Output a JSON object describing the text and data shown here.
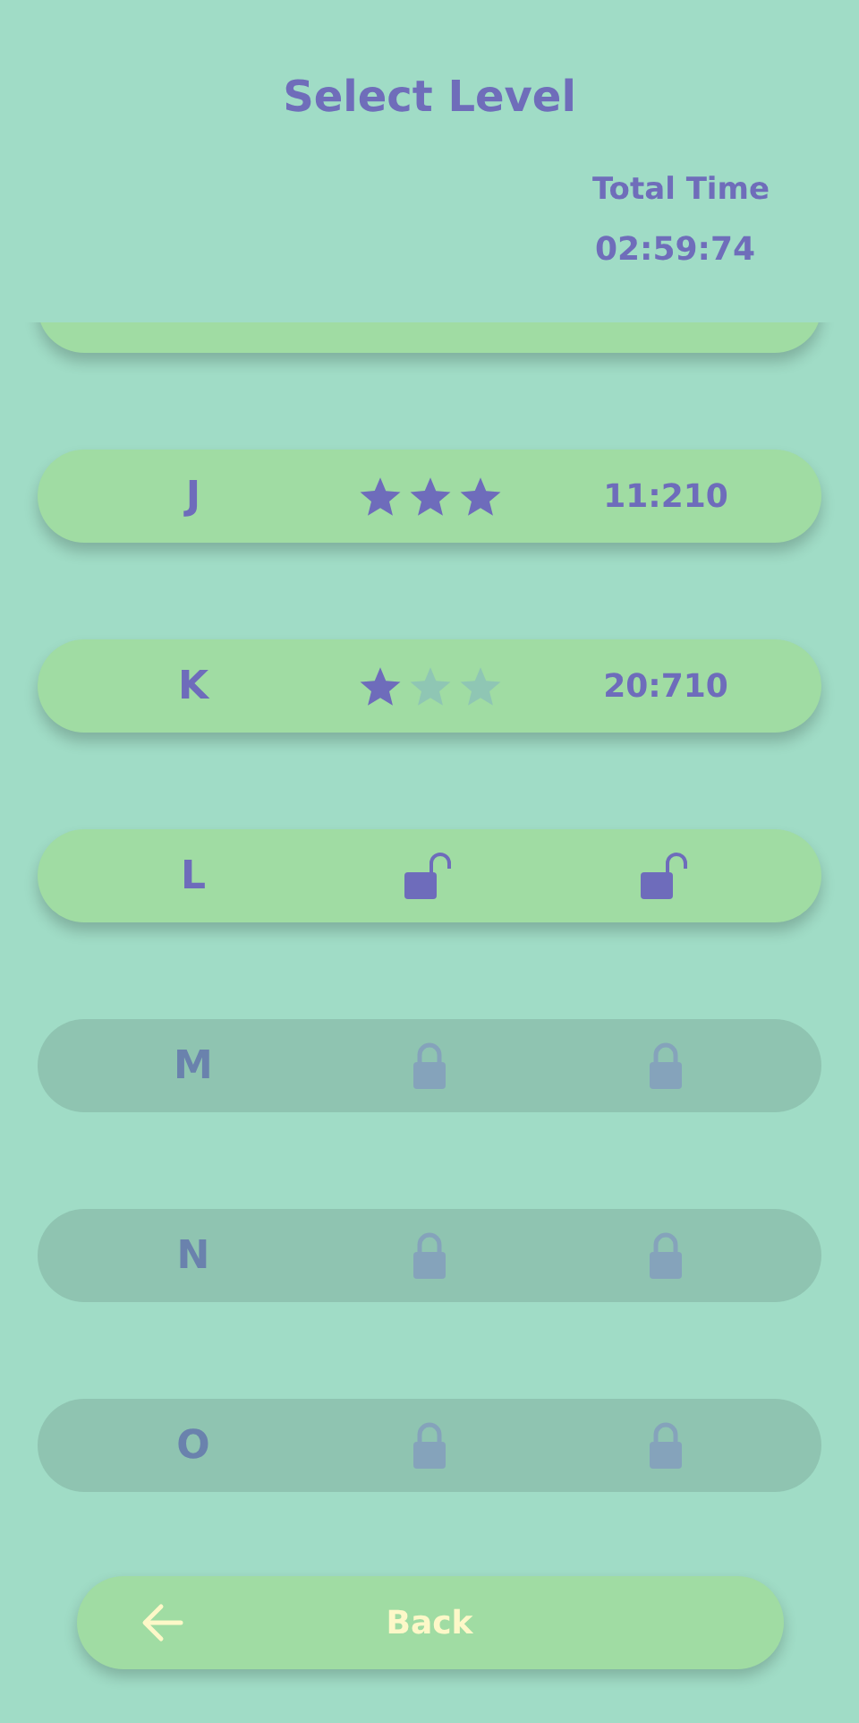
{
  "title": "Select Level",
  "total_time": {
    "label": "Total Time",
    "value": "02:59:74"
  },
  "levels": [
    {
      "kind": "partial"
    },
    {
      "kind": "stars",
      "label": "J",
      "stars": 3,
      "time": "11:210"
    },
    {
      "kind": "stars",
      "label": "K",
      "stars": 1,
      "time": "20:710"
    },
    {
      "kind": "unlocked",
      "label": "L"
    },
    {
      "kind": "locked",
      "label": "M"
    },
    {
      "kind": "locked",
      "label": "N"
    },
    {
      "kind": "locked",
      "label": "O"
    }
  ],
  "back_button": {
    "label": "Back"
  }
}
